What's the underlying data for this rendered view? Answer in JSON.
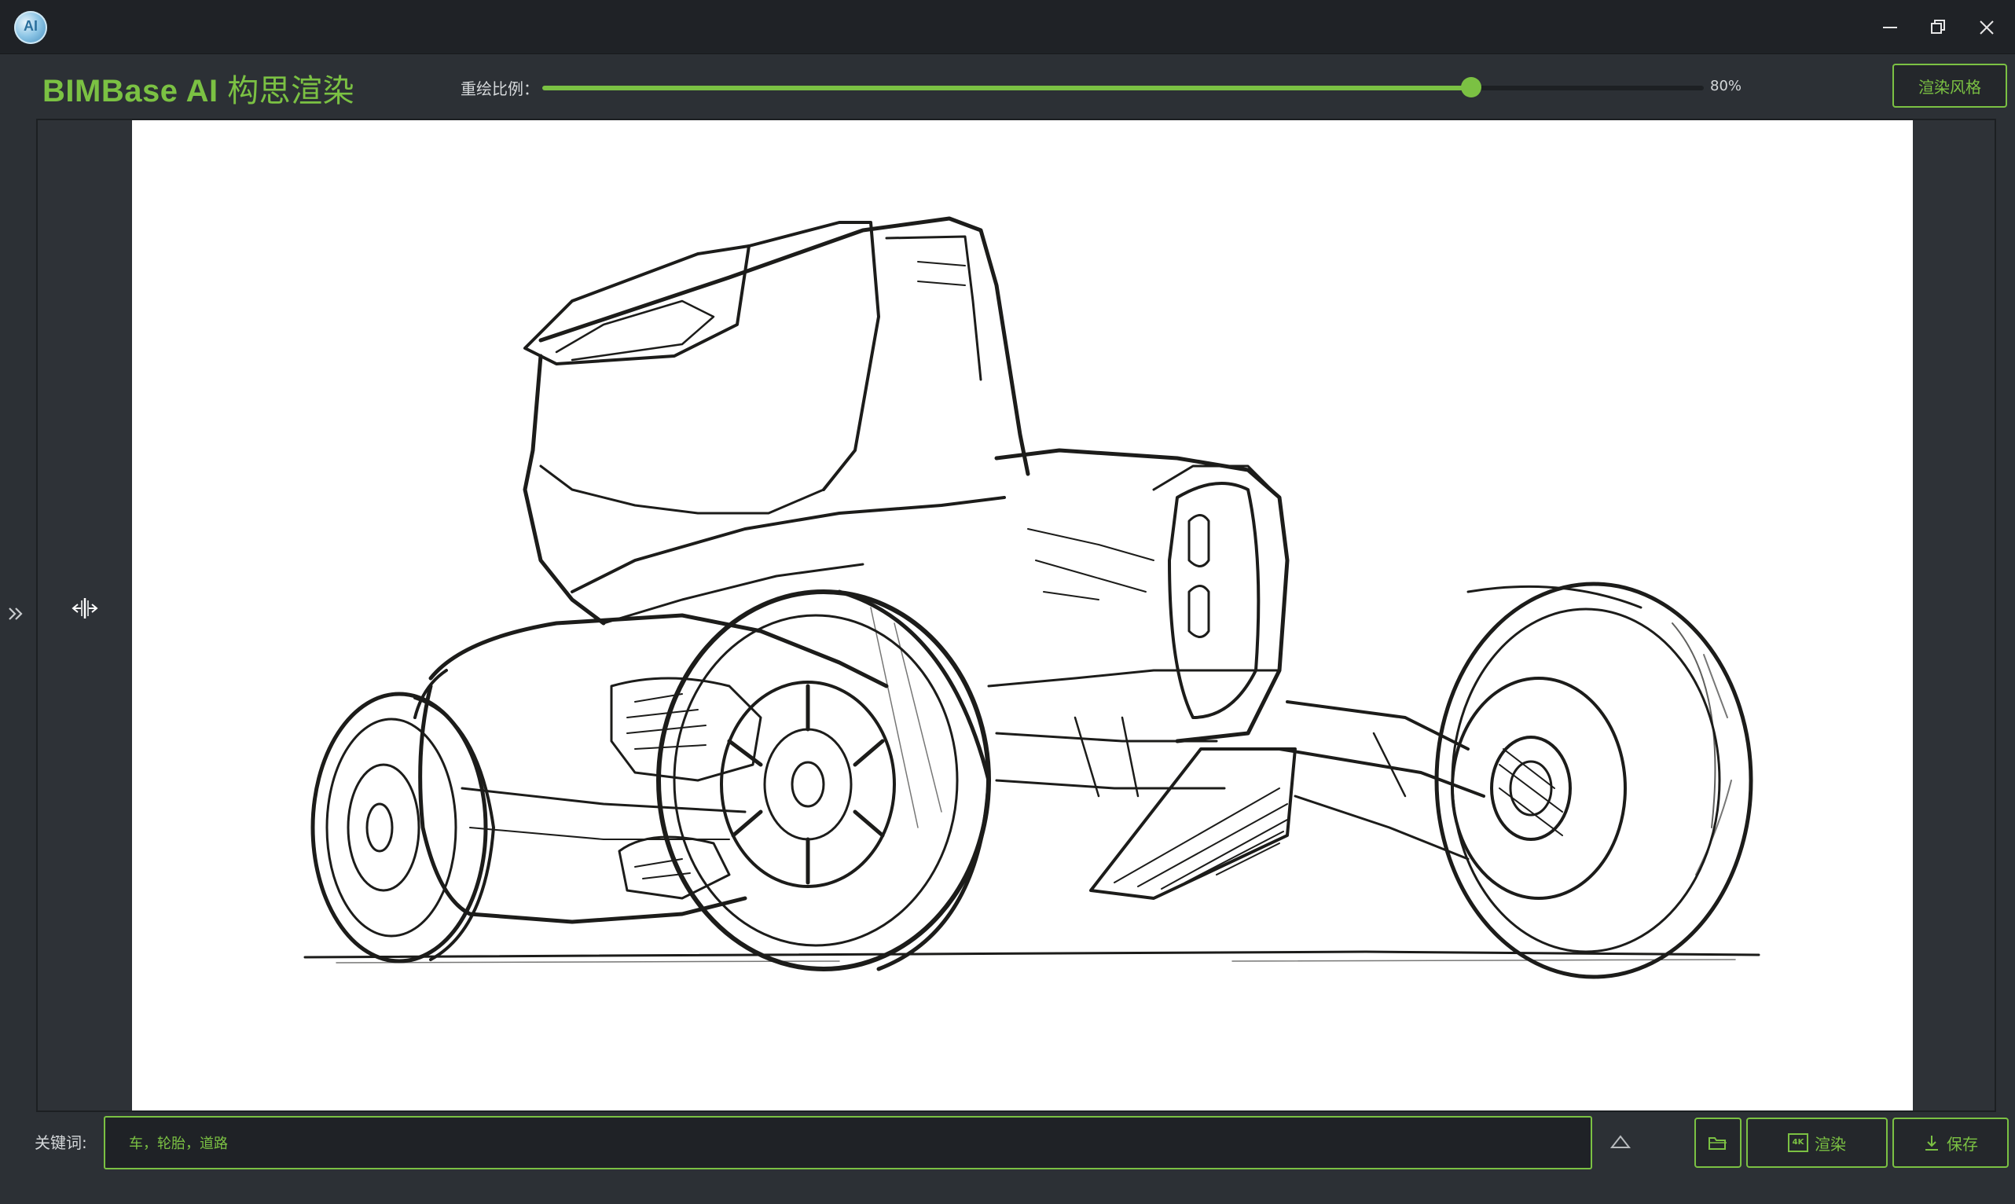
{
  "window": {
    "logo_text": "AI"
  },
  "toolbar": {
    "brand_latin": "BIMBase AI ",
    "brand_cn": "构思渲染",
    "ratio_label": "重绘比例：",
    "ratio_percent": 80,
    "ratio_value_text": "80%",
    "style_button_label": "渲染风格"
  },
  "canvas": {
    "image_description_icon": "car-sketch-image"
  },
  "bottom": {
    "keyword_label": "关键词:",
    "keyword_value": "车，轮胎，道路",
    "render_button_label": "渲染",
    "save_button_label": "保存",
    "render_icon_text": "4K"
  },
  "colors": {
    "accent": "#7bc143",
    "background": "#2c3035",
    "titlebar": "#1f2226"
  },
  "icons": {
    "minimize": "minimize-icon",
    "maximize": "restore-icon",
    "close": "close-icon",
    "side_toggle": "double-chevron-right-icon",
    "resize": "horizontal-resize-icon",
    "expand": "chevron-up-icon",
    "open": "folder-icon",
    "render": "4k-icon",
    "save": "download-icon"
  }
}
